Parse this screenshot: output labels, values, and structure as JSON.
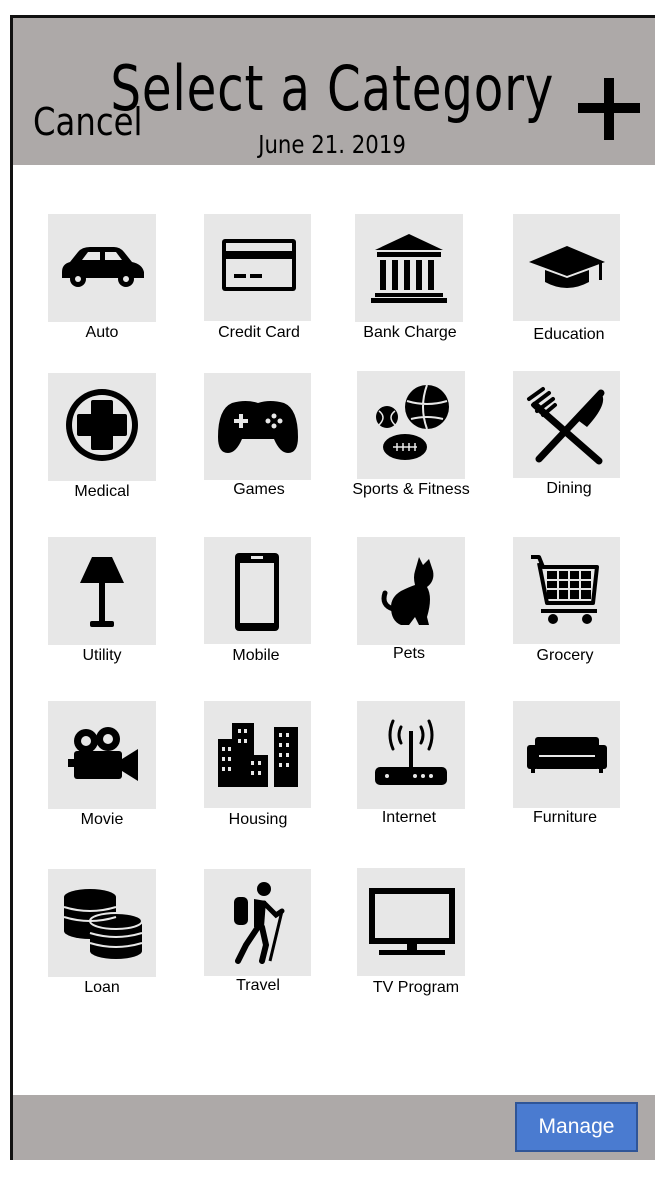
{
  "header": {
    "title": "Select a Category",
    "date": "June 21. 2019",
    "cancel_label": "Cancel",
    "add_icon": "plus-icon"
  },
  "categories": [
    {
      "label": "Auto",
      "icon": "car-icon"
    },
    {
      "label": "Credit Card",
      "icon": "credit-card-icon"
    },
    {
      "label": "Bank Charge",
      "icon": "bank-icon"
    },
    {
      "label": "Education",
      "icon": "graduation-cap-icon"
    },
    {
      "label": "Medical",
      "icon": "medical-cross-icon"
    },
    {
      "label": "Games",
      "icon": "gamepad-icon"
    },
    {
      "label": "Sports & Fitness",
      "icon": "sports-balls-icon"
    },
    {
      "label": "Dining",
      "icon": "fork-knife-icon"
    },
    {
      "label": "Utility",
      "icon": "lamp-icon"
    },
    {
      "label": "Mobile",
      "icon": "phone-icon"
    },
    {
      "label": "Pets",
      "icon": "cat-icon"
    },
    {
      "label": "Grocery",
      "icon": "shopping-cart-icon"
    },
    {
      "label": "Movie",
      "icon": "movie-camera-icon"
    },
    {
      "label": "Housing",
      "icon": "buildings-icon"
    },
    {
      "label": "Internet",
      "icon": "router-icon"
    },
    {
      "label": "Furniture",
      "icon": "sofa-icon"
    },
    {
      "label": "Loan",
      "icon": "coins-icon"
    },
    {
      "label": "Travel",
      "icon": "hiker-icon"
    },
    {
      "label": "TV Program",
      "icon": "tv-icon"
    }
  ],
  "footer": {
    "manage_label": "Manage"
  },
  "colors": {
    "bar": "#ada9a8",
    "tile": "#e7e7e7",
    "button": "#4a7bd0"
  }
}
